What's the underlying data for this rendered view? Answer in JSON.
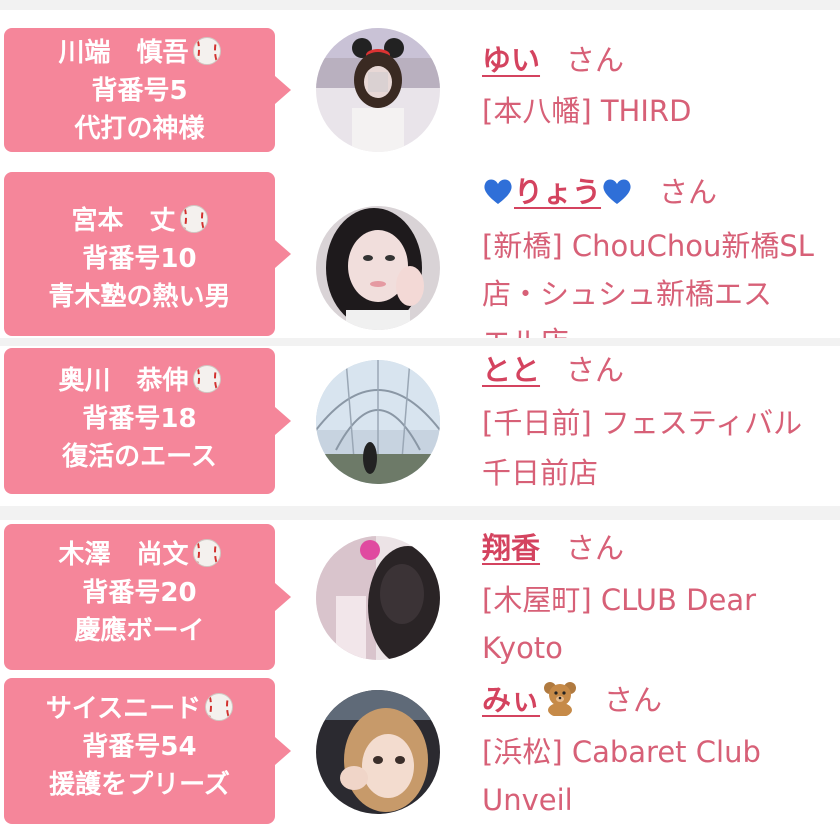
{
  "rows": [
    {
      "tag": {
        "line1": "川端　慎吾",
        "line2": "背番号5",
        "line3": "代打の神様"
      },
      "name": "ゆい",
      "honorific": "さん",
      "shop_line1": "[本八幡] THIRD",
      "shop_line2": ""
    },
    {
      "tag": {
        "line1": "宮本　丈",
        "line2": "背番号10",
        "line3": "青木塾の熱い男"
      },
      "name": "りょう",
      "honorific": "さん",
      "shop_line1": "[新橋] ChouChou新橋SL",
      "shop_line2": "店・シュシュ新橋エス",
      "shop_line3": "エル店"
    },
    {
      "tag": {
        "line1": "奥川　恭伸",
        "line2": "背番号18",
        "line3": "復活のエース"
      },
      "name": "とと",
      "honorific": "さん",
      "shop_line1": "[千日前] フェスティバル",
      "shop_line2": "千日前店"
    },
    {
      "tag": {
        "line1": "木澤　尚文",
        "line2": "背番号20",
        "line3": "慶應ボーイ"
      },
      "name": "翔香",
      "honorific": "さん",
      "shop_line1": "[木屋町] CLUB Dear",
      "shop_line2": "Kyoto"
    },
    {
      "tag": {
        "line1": "サイスニード",
        "line2": "背番号54",
        "line3": "援護をプリーズ"
      },
      "name": "みぃ",
      "honorific": "さん",
      "shop_line1": "[浜松] Cabaret Club",
      "shop_line2": "Unveil"
    }
  ],
  "colors": {
    "tag_bg": "#f5869a",
    "name": "#d4435f",
    "text": "#d76077",
    "separator": "#f2f2f2"
  },
  "icons": [
    "baseball-icon",
    "blue-heart-icon",
    "teddy-bear-icon"
  ]
}
